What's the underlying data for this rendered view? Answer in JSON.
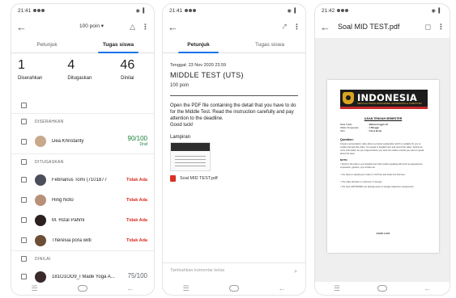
{
  "phone1": {
    "status": {
      "time": "21:41",
      "signal": "◉ ▍"
    },
    "header": {
      "points": "100 poin ▾"
    },
    "tabs": [
      {
        "label": "Petunjuk"
      },
      {
        "label": "Tugas siswa"
      }
    ],
    "stats": [
      {
        "value": "1",
        "label": "Diserahkan"
      },
      {
        "value": "4",
        "label": "Ditugaskan"
      },
      {
        "value": "46",
        "label": "Dinilai"
      }
    ],
    "sections": {
      "handed_in": "DISERAHKAN",
      "assigned": "DITUGASKAN",
      "graded": "DINILAI"
    },
    "handed_in": [
      {
        "name": "Dea Khristanty",
        "grade": "90/100",
        "sub": "Draf"
      }
    ],
    "assigned": [
      {
        "name": "Febrianus Tomi (7101877",
        "status": "Tidak Ada"
      },
      {
        "name": "Hing Noto",
        "status": "Tidak Ada"
      },
      {
        "name": "M. Rizal Pahmi",
        "status": "Tidak Ada"
      },
      {
        "name": "Theresia pora wilti",
        "status": "Tidak Ada"
      }
    ],
    "graded": [
      {
        "name": "181O1OO9_I Made Yoga A...",
        "grade": "75/100"
      }
    ]
  },
  "phone2": {
    "status": {
      "time": "21:41",
      "signal": "◉ ▍"
    },
    "tabs": [
      {
        "label": "Petunjuk"
      },
      {
        "label": "Tugas siswa"
      }
    ],
    "due": "Tenggat: 23 Nov 2020 23.59",
    "title": "MIDDLE TEST (UTS)",
    "points": "100 poin",
    "instructions": "Open the PDF file containing the detail that you have to do for the Middle Test. Read the instruction carefully and pay attention to the deadline.\nGood luck!",
    "attachments_label": "Lampiran",
    "file_name": "Soal MID TEST.pdf",
    "comment_placeholder": "Tambahkan komentar kelas"
  },
  "phone3": {
    "status": {
      "time": "21:42",
      "signal": "◉ ▍"
    },
    "title": "Soal MID TEST.pdf",
    "doc": {
      "brand": "INDONESIA",
      "brand_sub": "SEKOLAH TINGGI MANAJEMEN INFORMATIKA & KOMPUTER",
      "heading": "UJIAN TENGAH SEMESTER",
      "meta": [
        {
          "k": "Mata Kuliah",
          "v": ": Bahasa Inggris III"
        },
        {
          "k": "Waktu Pengerjaan",
          "v": ": 1 Minggu"
        },
        {
          "k": "Sifat",
          "v": ": Close Book"
        }
      ],
      "question_label": "Question:",
      "question_text": "Create a presentation video about a product explanation which is suitable for you to explain through this video. You speak in English here and record the video. Submit as more information as you request before you write the outline of what you want to speak about the topic.",
      "note_label": "NOTE:",
      "notes": [
        "Perform the task in your English and other public speaking skill such as appearance, expression, gesture, eye contact etc.",
        "You have to upload your video to YouTube and share the link here.",
        "The video duration is maximum 5 minutes.",
        "The topic ARTISPRES are already given to Google Classroom assignment."
      ],
      "sign": "GOOD LUCK"
    }
  }
}
